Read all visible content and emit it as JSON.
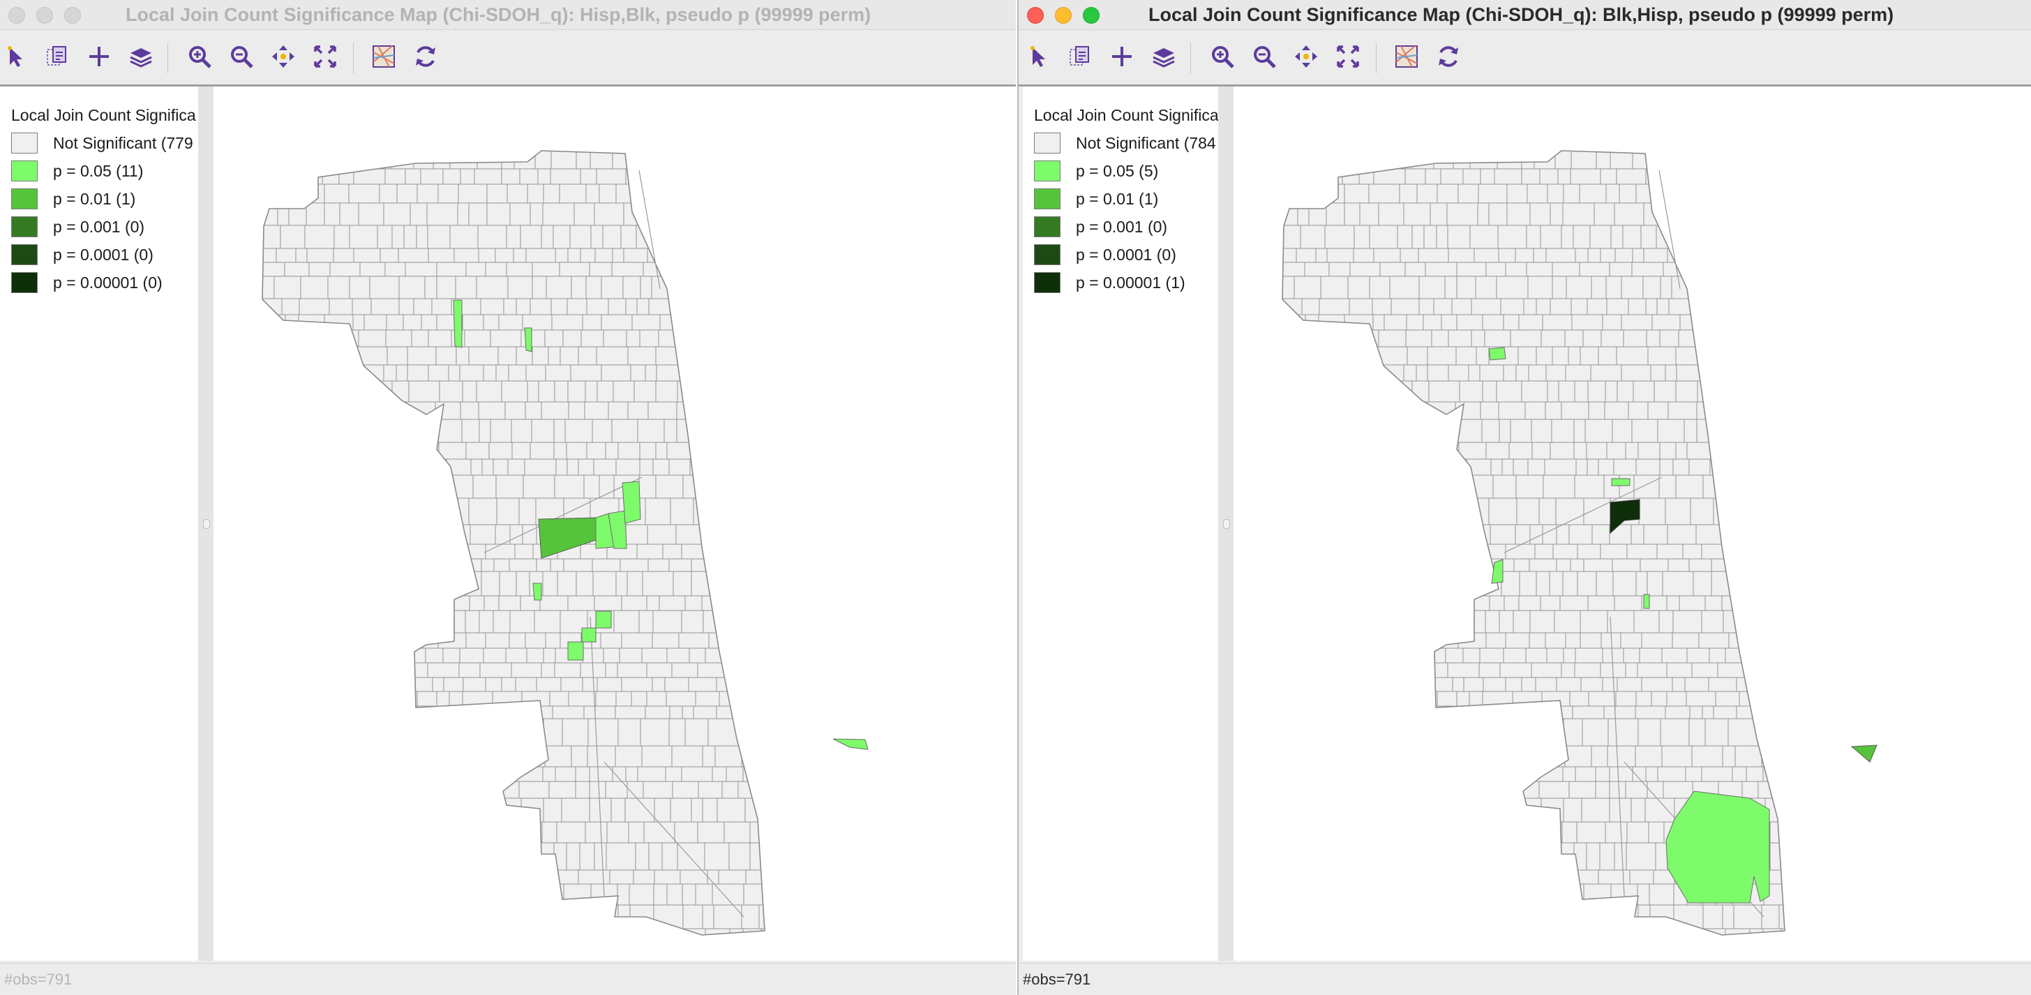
{
  "left_window": {
    "title": "Local Join Count Significance Map (Chi-SDOH_q): Hisp,Blk, pseudo p (99999 perm)",
    "legend": {
      "title": "Local Join Count Significa",
      "items": [
        {
          "label": "Not Significant (779",
          "color": "#f0f0f0"
        },
        {
          "label": "p = 0.05 (11)",
          "color": "#7dfb6a"
        },
        {
          "label": "p = 0.01 (1)",
          "color": "#56c43a"
        },
        {
          "label": "p = 0.001 (0)",
          "color": "#357a22"
        },
        {
          "label": "p = 0.0001 (0)",
          "color": "#1d4a14"
        },
        {
          "label": "p = 0.00001 (0)",
          "color": "#0f2e0a"
        }
      ]
    },
    "status": "#obs=791"
  },
  "right_window": {
    "title": "Local Join Count Significance Map (Chi-SDOH_q): Blk,Hisp, pseudo p (99999 perm)",
    "legend": {
      "title": "Local Join Count Significa",
      "items": [
        {
          "label": "Not Significant (784",
          "color": "#f0f0f0"
        },
        {
          "label": "p = 0.05 (5)",
          "color": "#7dfb6a"
        },
        {
          "label": "p = 0.01 (1)",
          "color": "#56c43a"
        },
        {
          "label": "p = 0.001 (0)",
          "color": "#357a22"
        },
        {
          "label": "p = 0.0001 (0)",
          "color": "#1d4a14"
        },
        {
          "label": "p = 0.00001 (1)",
          "color": "#0f2e0a"
        }
      ]
    },
    "status": "#obs=791"
  },
  "toolbar_icons": [
    "select-icon",
    "select-layer-icon",
    "add-layer-icon",
    "layers-icon",
    "zoom-in-icon",
    "zoom-out-icon",
    "pan-icon",
    "fit-extent-icon",
    "basemap-icon",
    "refresh-icon"
  ],
  "colors": {
    "icon_purple": "#5d3b9c",
    "map_fill": "#f0f0f0",
    "map_stroke": "#8f8f8f"
  }
}
